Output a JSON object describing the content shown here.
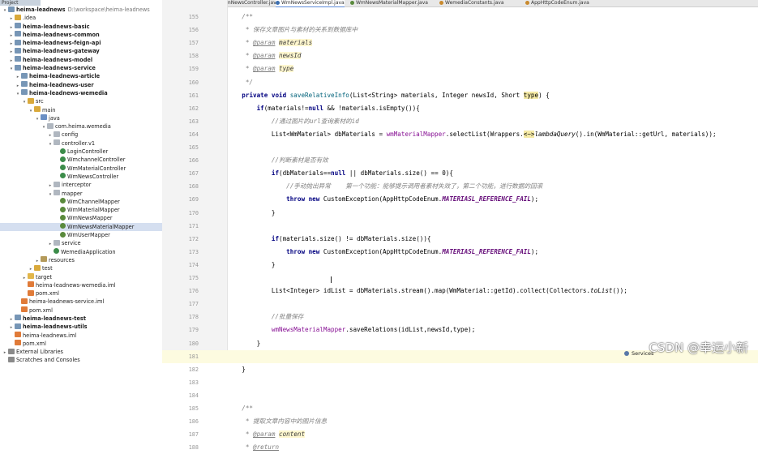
{
  "project": {
    "header": "Project",
    "rows": [
      {
        "arrow": "▾",
        "icon": "module",
        "label": "heima-leadnews",
        "path": "D:\\workspace\\heima-leadnews",
        "bold": true,
        "indent": 0
      },
      {
        "arrow": "▸",
        "icon": "folder",
        "label": ".idea",
        "indent": 1
      },
      {
        "arrow": "▸",
        "icon": "module",
        "label": "heima-leadnews-basic",
        "bold": true,
        "indent": 1
      },
      {
        "arrow": "▸",
        "icon": "module",
        "label": "heima-leadnews-common",
        "bold": true,
        "indent": 1
      },
      {
        "arrow": "▸",
        "icon": "module",
        "label": "heima-leadnews-feign-api",
        "bold": true,
        "indent": 1
      },
      {
        "arrow": "▸",
        "icon": "module",
        "label": "heima-leadnews-gateway",
        "bold": true,
        "indent": 1
      },
      {
        "arrow": "▸",
        "icon": "module",
        "label": "heima-leadnews-model",
        "bold": true,
        "indent": 1
      },
      {
        "arrow": "▾",
        "icon": "module",
        "label": "heima-leadnews-service",
        "bold": true,
        "indent": 1
      },
      {
        "arrow": "▸",
        "icon": "module",
        "label": "heima-leadnews-article",
        "bold": true,
        "indent": 2
      },
      {
        "arrow": "▸",
        "icon": "module",
        "label": "heima-leadnews-user",
        "bold": true,
        "indent": 2
      },
      {
        "arrow": "▾",
        "icon": "module",
        "label": "heima-leadnews-wemedia",
        "bold": true,
        "indent": 2
      },
      {
        "arrow": "▾",
        "icon": "folder",
        "label": "src",
        "indent": 3
      },
      {
        "arrow": "▾",
        "icon": "folder",
        "label": "main",
        "indent": 4
      },
      {
        "arrow": "▾",
        "icon": "src",
        "label": "java",
        "indent": 5
      },
      {
        "arrow": "▾",
        "icon": "pkg",
        "label": "com.heima.wemedia",
        "indent": 6
      },
      {
        "arrow": "▸",
        "icon": "pkg",
        "label": "config",
        "indent": 7
      },
      {
        "arrow": "▾",
        "icon": "pkg",
        "label": "controller.v1",
        "indent": 7
      },
      {
        "arrow": "",
        "icon": "cls",
        "label": "LoginController",
        "indent": 8
      },
      {
        "arrow": "",
        "icon": "cls",
        "label": "WmchannelController",
        "indent": 8
      },
      {
        "arrow": "",
        "icon": "cls",
        "label": "WmMaterialController",
        "indent": 8
      },
      {
        "arrow": "",
        "icon": "cls",
        "label": "WmNewsController",
        "indent": 8
      },
      {
        "arrow": "▸",
        "icon": "pkg",
        "label": "interceptor",
        "indent": 7
      },
      {
        "arrow": "▾",
        "icon": "pkg",
        "label": "mapper",
        "indent": 7
      },
      {
        "arrow": "",
        "icon": "iface",
        "label": "WmChannelMapper",
        "indent": 8
      },
      {
        "arrow": "",
        "icon": "iface",
        "label": "WmMaterialMapper",
        "indent": 8
      },
      {
        "arrow": "",
        "icon": "iface",
        "label": "WmNewsMapper",
        "indent": 8
      },
      {
        "arrow": "",
        "icon": "iface",
        "label": "WmNewsMaterialMapper",
        "indent": 8,
        "selected": true
      },
      {
        "arrow": "",
        "icon": "iface",
        "label": "WmUserMapper",
        "indent": 8
      },
      {
        "arrow": "▸",
        "icon": "pkg",
        "label": "service",
        "indent": 7
      },
      {
        "arrow": "",
        "icon": "cls",
        "label": "WemediaApplication",
        "indent": 7
      },
      {
        "arrow": "▸",
        "icon": "res",
        "label": "resources",
        "indent": 5
      },
      {
        "arrow": "▸",
        "icon": "folder",
        "label": "test",
        "indent": 4
      },
      {
        "arrow": "▸",
        "icon": "target",
        "label": "target",
        "indent": 3
      },
      {
        "arrow": "",
        "icon": "xml",
        "label": "heima-leadnews-wemedia.iml",
        "indent": 3
      },
      {
        "arrow": "",
        "icon": "xml",
        "label": "pom.xml",
        "indent": 3
      },
      {
        "arrow": "",
        "icon": "xml",
        "label": "heima-leadnews-service.iml",
        "indent": 2
      },
      {
        "arrow": "",
        "icon": "xml",
        "label": "pom.xml",
        "indent": 2
      },
      {
        "arrow": "▸",
        "icon": "module",
        "label": "heima-leadnews-test",
        "bold": true,
        "indent": 1
      },
      {
        "arrow": "▸",
        "icon": "module",
        "label": "heima-leadnews-utils",
        "bold": true,
        "indent": 1
      },
      {
        "arrow": "",
        "icon": "xml",
        "label": "heima-leadnews.iml",
        "indent": 1
      },
      {
        "arrow": "",
        "icon": "xml",
        "label": "pom.xml",
        "indent": 1
      },
      {
        "arrow": "▸",
        "icon": "lib",
        "label": "External Libraries",
        "indent": 0
      },
      {
        "arrow": "",
        "icon": "lib",
        "label": "Scratches and Consoles",
        "indent": 0
      }
    ]
  },
  "tabs": [
    {
      "label": "WmNewsController.java",
      "active": false
    },
    {
      "label": "WmNewsServiceImpl.java",
      "active": true
    },
    {
      "label": "WmNewsMaterialMapper.java",
      "active": false
    },
    {
      "label": "WemediaConstants.java",
      "active": false
    },
    {
      "label": "AppHttpCodeEnum.java",
      "active": false
    }
  ],
  "editor": {
    "lines": [
      {
        "n": "155",
        "segs": [
          [
            "    /**",
            "cm"
          ]
        ]
      },
      {
        "n": "156",
        "segs": [
          [
            "     * 保存文章图片与素材的关系到数据库中",
            "cm"
          ]
        ]
      },
      {
        "n": "157",
        "segs": [
          [
            "     * ",
            "cm"
          ],
          [
            "@param",
            "ann"
          ],
          [
            " ",
            "cm"
          ],
          [
            "materials",
            "pv"
          ]
        ]
      },
      {
        "n": "158",
        "segs": [
          [
            "     * ",
            "cm"
          ],
          [
            "@param",
            "ann"
          ],
          [
            " ",
            "cm"
          ],
          [
            "newsId",
            "pv"
          ]
        ]
      },
      {
        "n": "159",
        "segs": [
          [
            "     * ",
            "cm"
          ],
          [
            "@param",
            "ann"
          ],
          [
            " ",
            "cm"
          ],
          [
            "type",
            "pv"
          ]
        ]
      },
      {
        "n": "160",
        "segs": [
          [
            "     */",
            "cm"
          ]
        ]
      },
      {
        "n": "161",
        "segs": [
          [
            "    ",
            ""
          ],
          [
            "private void ",
            "kw"
          ],
          [
            "saveRelativeInfo",
            "fn"
          ],
          [
            "(List<String> materials, Integer newsId, Short ",
            ""
          ],
          [
            "type",
            "hl"
          ],
          [
            ") {",
            ""
          ]
        ]
      },
      {
        "n": "162",
        "segs": [
          [
            "        ",
            ""
          ],
          [
            "if",
            "kw"
          ],
          [
            "(materials!=",
            ""
          ],
          [
            "null",
            "kw"
          ],
          [
            " && !materials.isEmpty()){",
            ""
          ]
        ]
      },
      {
        "n": "163",
        "segs": [
          [
            "            //通过图片的url查询素材的id",
            "cm"
          ]
        ]
      },
      {
        "n": "164",
        "segs": [
          [
            "            List<WmMaterial> dbMaterials = ",
            ""
          ],
          [
            "wmMaterialMapper",
            "mem"
          ],
          [
            ".selectList(Wrappers.",
            ""
          ],
          [
            "<~>",
            "hl"
          ],
          [
            "lambdaQuery",
            "stat"
          ],
          [
            "().in(WmMaterial::getUrl, materials));",
            ""
          ]
        ]
      },
      {
        "n": "165",
        "segs": [
          [
            "",
            ""
          ]
        ]
      },
      {
        "n": "166",
        "segs": [
          [
            "            //判断素材是否有效",
            "cm"
          ]
        ]
      },
      {
        "n": "167",
        "segs": [
          [
            "            ",
            ""
          ],
          [
            "if",
            "kw"
          ],
          [
            "(dbMaterials==",
            ""
          ],
          [
            "null",
            "kw"
          ],
          [
            " || dbMaterials.size() == 0){",
            ""
          ]
        ]
      },
      {
        "n": "168",
        "segs": [
          [
            "                //手动抛出异常    第一个功能：能够提示调用者素材失效了，第二个功能，进行数据的回滚",
            "cm"
          ]
        ]
      },
      {
        "n": "169",
        "segs": [
          [
            "                ",
            ""
          ],
          [
            "throw new ",
            "kw"
          ],
          [
            "CustomException(AppHttpCodeEnum.",
            ""
          ],
          [
            "MATERIASL_REFERENCE_FAIL",
            "fld"
          ],
          [
            ");",
            ""
          ]
        ]
      },
      {
        "n": "170",
        "segs": [
          [
            "            }",
            ""
          ]
        ]
      },
      {
        "n": "171",
        "segs": [
          [
            "",
            ""
          ]
        ]
      },
      {
        "n": "172",
        "segs": [
          [
            "            ",
            ""
          ],
          [
            "if",
            "kw"
          ],
          [
            "(materials.size() != dbMaterials.size()){",
            ""
          ]
        ]
      },
      {
        "n": "173",
        "segs": [
          [
            "                ",
            ""
          ],
          [
            "throw new ",
            "kw"
          ],
          [
            "CustomException(AppHttpCodeEnum.",
            ""
          ],
          [
            "MATERIASL_REFERENCE_FAIL",
            "fld"
          ],
          [
            ");",
            ""
          ]
        ]
      },
      {
        "n": "174",
        "segs": [
          [
            "            }",
            ""
          ]
        ]
      },
      {
        "n": "175",
        "segs": [
          [
            "",
            ""
          ]
        ]
      },
      {
        "n": "176",
        "segs": [
          [
            "            List<Integer> idList = dbMaterials.stream().map(WmMaterial::getId).collect(Collectors.",
            ""
          ],
          [
            "toList",
            "stat"
          ],
          [
            "());",
            ""
          ]
        ]
      },
      {
        "n": "177",
        "segs": [
          [
            "",
            ""
          ]
        ]
      },
      {
        "n": "178",
        "segs": [
          [
            "            //批量保存",
            "cm"
          ]
        ]
      },
      {
        "n": "179",
        "segs": [
          [
            "            ",
            ""
          ],
          [
            "wmNewsMaterialMapper",
            "mem"
          ],
          [
            ".saveRelations(idList,newsId,type);",
            ""
          ]
        ]
      },
      {
        "n": "180",
        "segs": [
          [
            "        }",
            ""
          ]
        ]
      },
      {
        "n": "181",
        "segs": [
          [
            "",
            ""
          ]
        ],
        "current": true
      },
      {
        "n": "182",
        "segs": [
          [
            "    }",
            ""
          ]
        ]
      },
      {
        "n": "183",
        "segs": [
          [
            "",
            ""
          ]
        ]
      },
      {
        "n": "184",
        "segs": [
          [
            "",
            ""
          ]
        ]
      },
      {
        "n": "185",
        "segs": [
          [
            "    /**",
            "cm"
          ]
        ]
      },
      {
        "n": "186",
        "segs": [
          [
            "     * 提取文章内容中的图片信息",
            "cm"
          ]
        ]
      },
      {
        "n": "187",
        "segs": [
          [
            "     * ",
            "cm"
          ],
          [
            "@param",
            "ann"
          ],
          [
            " ",
            "cm"
          ],
          [
            "content",
            "pv"
          ]
        ]
      },
      {
        "n": "188",
        "segs": [
          [
            "     * ",
            "cm"
          ],
          [
            "@return",
            "ann"
          ]
        ]
      }
    ]
  },
  "status": {
    "services_label": "Services",
    "watermark": "CSDN @幸运小新"
  }
}
